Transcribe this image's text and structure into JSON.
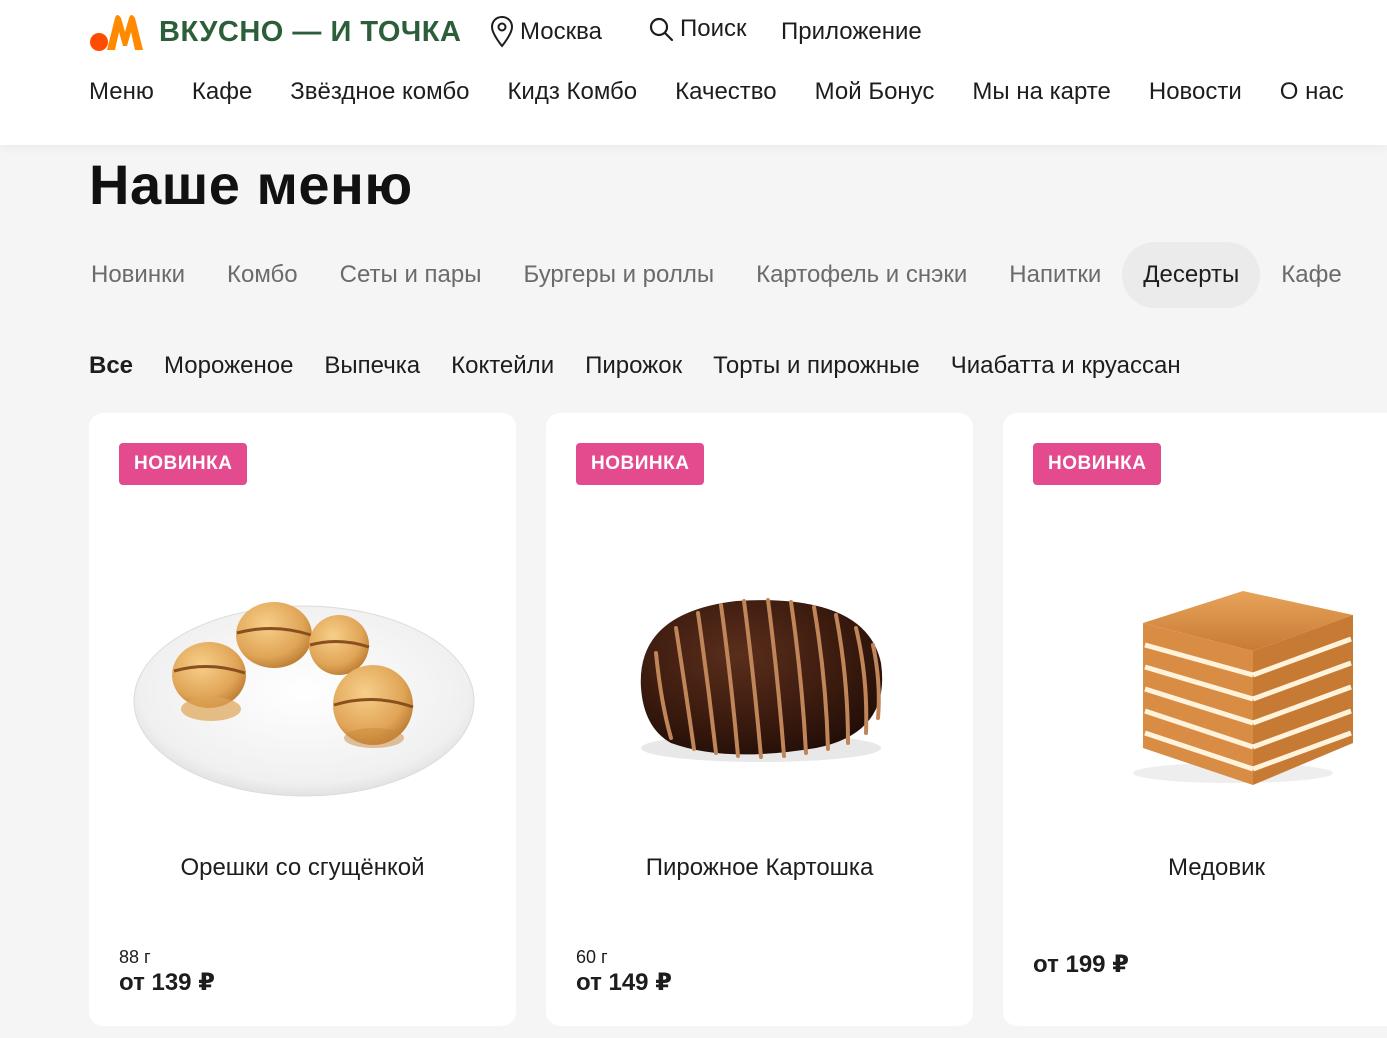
{
  "brand": {
    "logo_text": "ВКУСНО — И ТОЧКА",
    "colors": {
      "logo_green": "#2c5e3a",
      "logo_orange": "#ff8a00",
      "logo_red": "#ff4d00"
    }
  },
  "header": {
    "city": "Москва",
    "search_label": "Поиск",
    "app_label": "Приложение",
    "nav": [
      "Меню",
      "Кафе",
      "Звёздное комбо",
      "Кидз Комбо",
      "Качество",
      "Мой Бонус",
      "Мы на карте",
      "Новости",
      "О нас"
    ]
  },
  "page": {
    "title": "Наше меню"
  },
  "categories": {
    "items": [
      "Новинки",
      "Комбо",
      "Сеты и пары",
      "Бургеры и роллы",
      "Картофель и снэки",
      "Напитки",
      "Десерты",
      "Кафе"
    ],
    "active": "Десерты"
  },
  "subcategories": {
    "items": [
      "Все",
      "Мороженое",
      "Выпечка",
      "Коктейли",
      "Пирожок",
      "Торты и пирожные",
      "Чиабатта и круассан"
    ],
    "active": "Все"
  },
  "products": [
    {
      "badge": "НОВИНКА",
      "name": "Орешки со сгущёнкой",
      "weight": "88 г",
      "price": "от 139 ₽",
      "image": "nut-cookies-plate"
    },
    {
      "badge": "НОВИНКА",
      "name": "Пирожное Картошка",
      "weight": "60 г",
      "price": "от 149 ₽",
      "image": "chocolate-kartoshka"
    },
    {
      "badge": "НОВИНКА",
      "name": "Медовик",
      "weight": "",
      "price": "от 199 ₽",
      "image": "honey-cake-slice"
    }
  ],
  "colors": {
    "badge": "#e34b8e",
    "active_category_bg": "#ebebeb",
    "page_bg": "#f5f5f5"
  }
}
